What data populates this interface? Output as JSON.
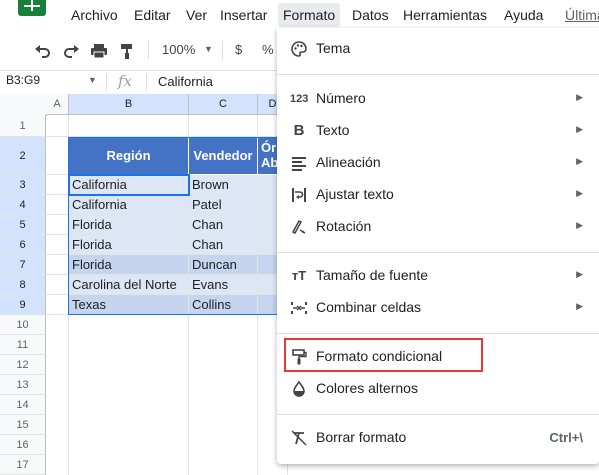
{
  "menubar": {
    "items": [
      "Archivo",
      "Editar",
      "Ver",
      "Insertar",
      "Formato",
      "Datos",
      "Herramientas",
      "Ayuda",
      "Última"
    ]
  },
  "toolbar": {
    "zoom": "100%",
    "currency": "$",
    "percent": "%"
  },
  "formula_bar": {
    "name_box": "B3:G9",
    "fx": "fx",
    "value": "California"
  },
  "grid": {
    "columns": [
      "A",
      "B",
      "C",
      "D"
    ],
    "rows": [
      "1",
      "2",
      "3",
      "4",
      "5",
      "6",
      "7",
      "8",
      "9",
      "10",
      "11",
      "12",
      "13",
      "14",
      "15",
      "16",
      "17"
    ],
    "headers": [
      "Región",
      "Vendedor",
      "Ór",
      "Ab"
    ],
    "data": [
      [
        "California",
        "Brown"
      ],
      [
        "California",
        "Patel"
      ],
      [
        "Florida",
        "Chan"
      ],
      [
        "Florida",
        "Chan"
      ],
      [
        "Florida",
        "Duncan"
      ],
      [
        "Carolina del Norte",
        "Evans"
      ],
      [
        "Texas",
        "Collins"
      ]
    ]
  },
  "format_menu": {
    "items": [
      {
        "icon": "palette-icon",
        "label": "Tema"
      },
      {
        "icon": "number-icon",
        "label": "Número",
        "submenu": true
      },
      {
        "icon": "bold-icon",
        "label": "Texto",
        "submenu": true
      },
      {
        "icon": "align-icon",
        "label": "Alineación",
        "submenu": true
      },
      {
        "icon": "wrap-icon",
        "label": "Ajustar texto",
        "submenu": true
      },
      {
        "icon": "rotation-icon",
        "label": "Rotación",
        "submenu": true
      },
      {
        "icon": "font-size-icon",
        "label": "Tamaño de fuente",
        "submenu": true
      },
      {
        "icon": "merge-icon",
        "label": "Combinar celdas",
        "submenu": true
      },
      {
        "icon": "paint-roller-icon",
        "label": "Formato condicional"
      },
      {
        "icon": "fill-drop-icon",
        "label": "Colores alternos"
      },
      {
        "icon": "clear-format-icon",
        "label": "Borrar formato",
        "shortcut": "Ctrl+\\"
      }
    ]
  },
  "colors": {
    "header_blue": "#4472c4",
    "band_dark": "#c5d5ef",
    "band_light": "#dce6f4",
    "selection": "#1a73e8",
    "highlight_red": "#e53935"
  }
}
